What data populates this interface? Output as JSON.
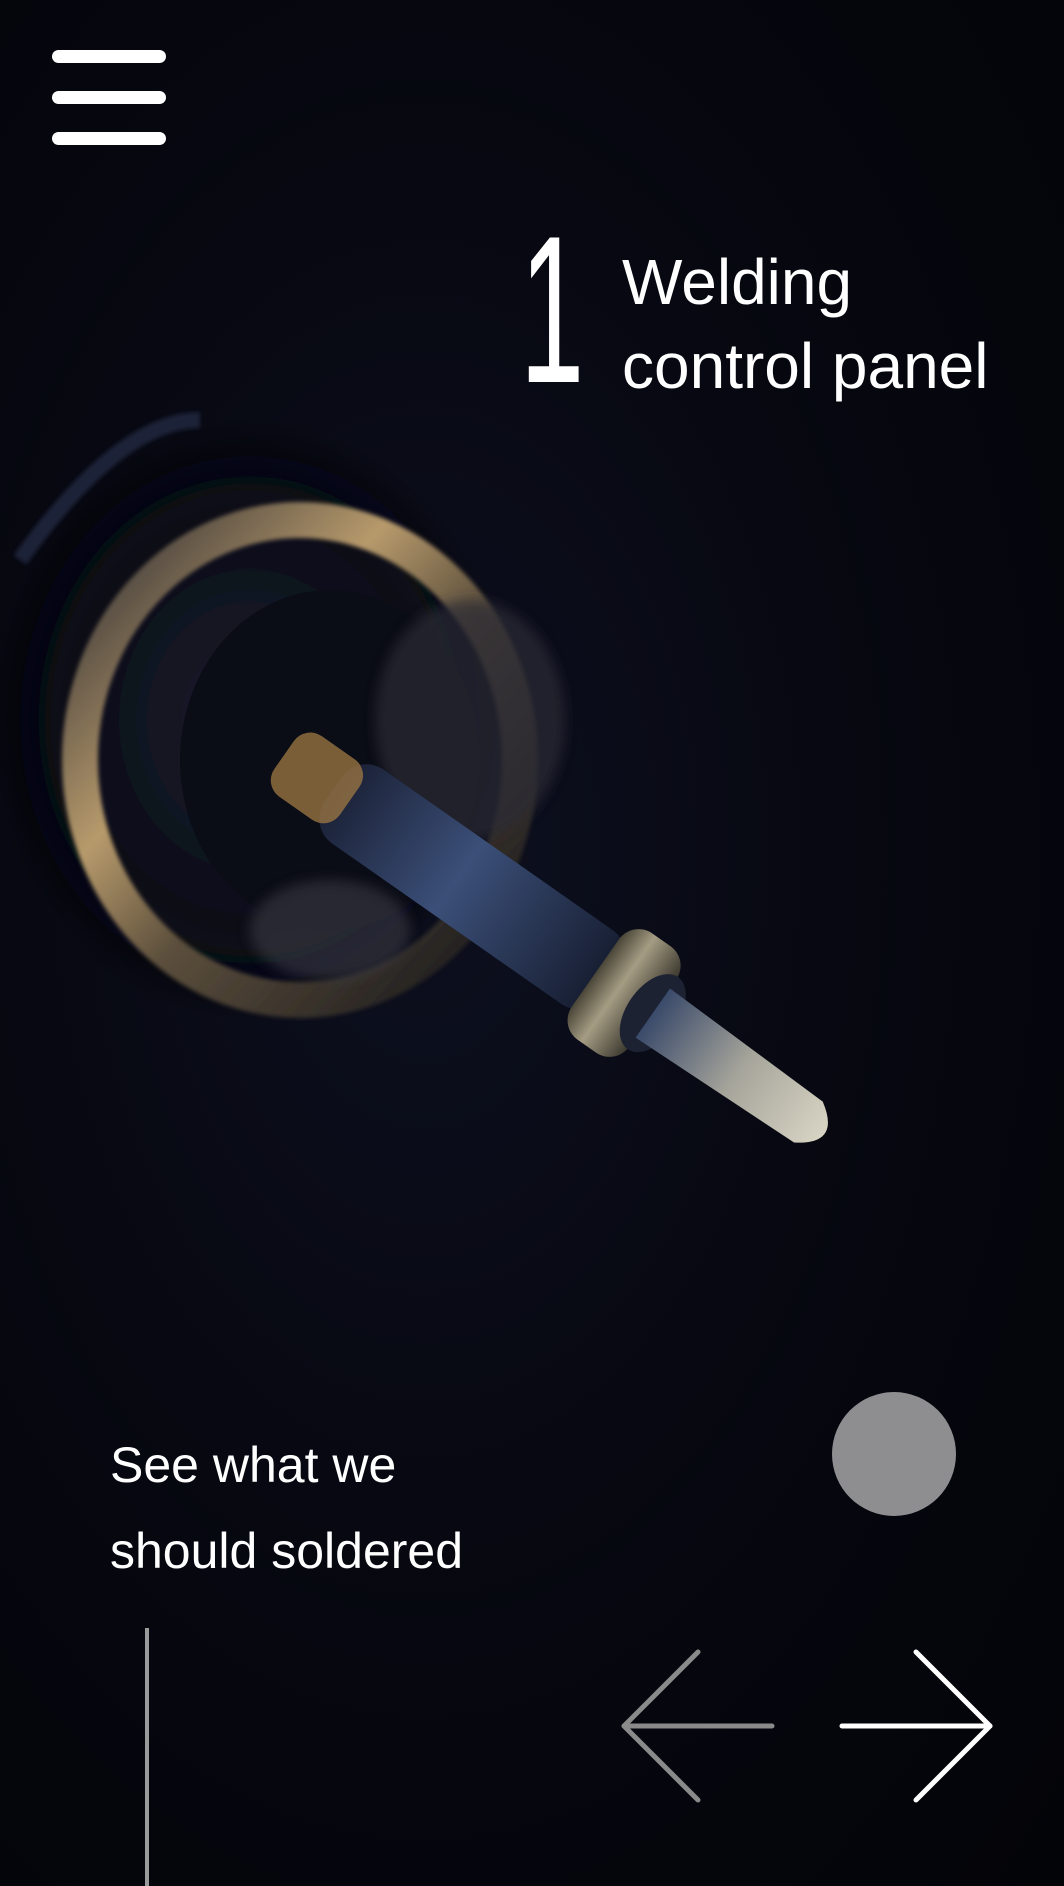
{
  "hero": {
    "image_description_icon": "soldering-tip-photo"
  },
  "header": {
    "menu_icon": "hamburger-menu-icon"
  },
  "step": {
    "number": "1",
    "title_line1": "Welding",
    "title_line2": "control panel"
  },
  "cta": {
    "line1": "See what we",
    "line2": "should soldered"
  },
  "navigation": {
    "prev_icon": "arrow-left-icon",
    "next_icon": "arrow-right-icon"
  },
  "colors": {
    "background": "#05060b",
    "text": "#ffffff",
    "dot": "#8e8e90",
    "arrow_prev": "#8a8a8a",
    "arrow_next": "#ffffff",
    "scroll_line": "#9a9a9a"
  }
}
